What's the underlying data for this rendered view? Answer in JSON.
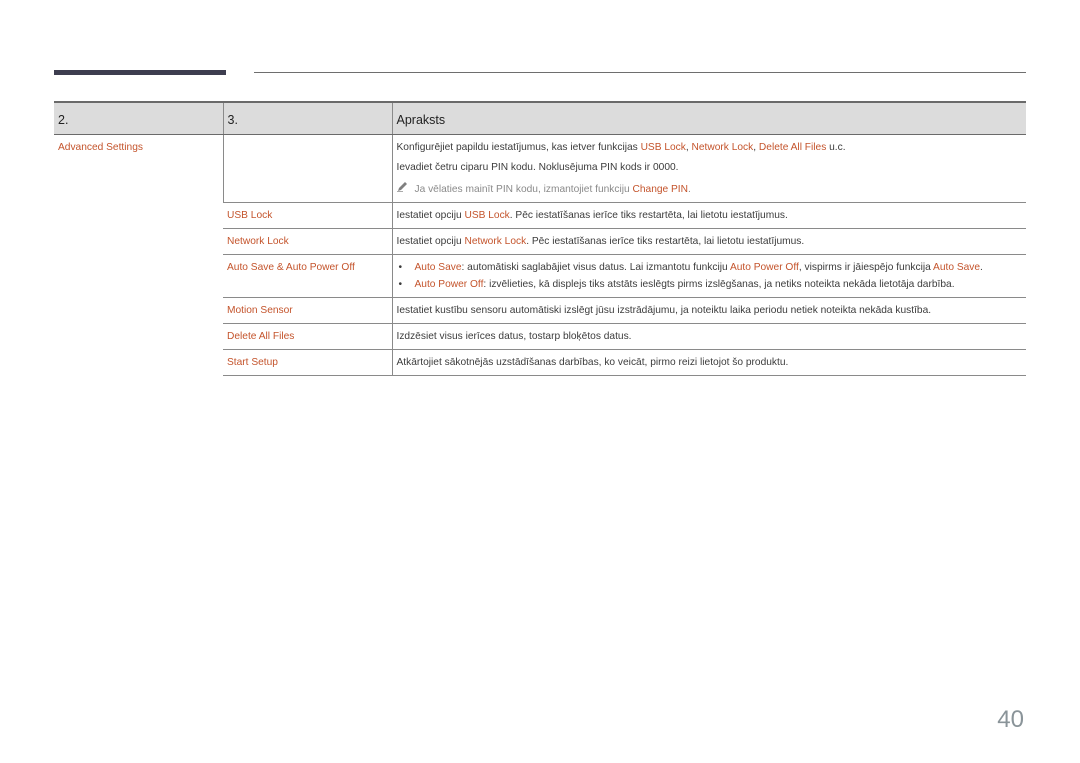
{
  "header": {
    "columns": [
      "2.",
      "3.",
      "Apraksts"
    ]
  },
  "rows": {
    "advanced": {
      "col2": "Advanced Settings",
      "line1": {
        "pre": "Konfigurējiet papildu iestatījumus, kas ietver funkcijas ",
        "h1": "USB Lock",
        "s1": ", ",
        "h2": "Network Lock",
        "s2": ", ",
        "h3": "Delete All Files",
        "post": " u.c."
      },
      "line2": "Ievadiet četru ciparu PIN kodu. Noklusējuma PIN kods ir 0000.",
      "note": {
        "icon": "pencil-icon",
        "pre": "Ja vēlaties mainīt PIN kodu, izmantojiet funkciju ",
        "h": "Change PIN",
        "post": "."
      }
    },
    "usb_lock": {
      "col3": "USB Lock",
      "desc": {
        "pre": "Iestatiet opciju ",
        "h": "USB Lock",
        "post": ". Pēc iestatīšanas ierīce tiks restartēta, lai lietotu iestatījumus."
      }
    },
    "network_lock": {
      "col3": "Network Lock",
      "desc": {
        "pre": "Iestatiet opciju ",
        "h": "Network Lock",
        "post": ". Pēc iestatīšanas ierīce tiks restartēta, lai lietotu iestatījumus."
      }
    },
    "auto_save": {
      "col3": "Auto Save & Auto Power Off",
      "bullet1": {
        "h1": "Auto Save",
        "mid": ": automātiski saglabājiet visus datus. Lai izmantotu funkciju ",
        "h2": "Auto Power Off",
        "mid2": ", vispirms ir jāiespējo funkcija ",
        "h3": "Auto Save",
        "post": "."
      },
      "bullet2": {
        "h1": "Auto Power Off",
        "post": ": izvēlieties, kā displejs tiks atstāts ieslēgts pirms izslēgšanas, ja netiks noteikta nekāda lietotāja darbība."
      }
    },
    "motion_sensor": {
      "col3": "Motion Sensor",
      "desc": "Iestatiet kustību sensoru automātiski izslēgt jūsu izstrādājumu, ja noteiktu laika periodu netiek noteikta nekāda kustība."
    },
    "delete_all": {
      "col3": "Delete All Files",
      "desc": "Izdzēsiet visus ierīces datus, tostarp bloķētos datus."
    },
    "start_setup": {
      "col3": "Start Setup",
      "desc": "Atkārtojiet sākotnējās uzstādīšanas darbības, ko veicāt, pirmo reizi lietojot šo produktu."
    }
  },
  "bullet_char": "•",
  "page_number": "40",
  "colors": {
    "highlight": "#c4542c",
    "header_bg": "#dcdcdc",
    "top_bar": "#3d3d4f"
  }
}
